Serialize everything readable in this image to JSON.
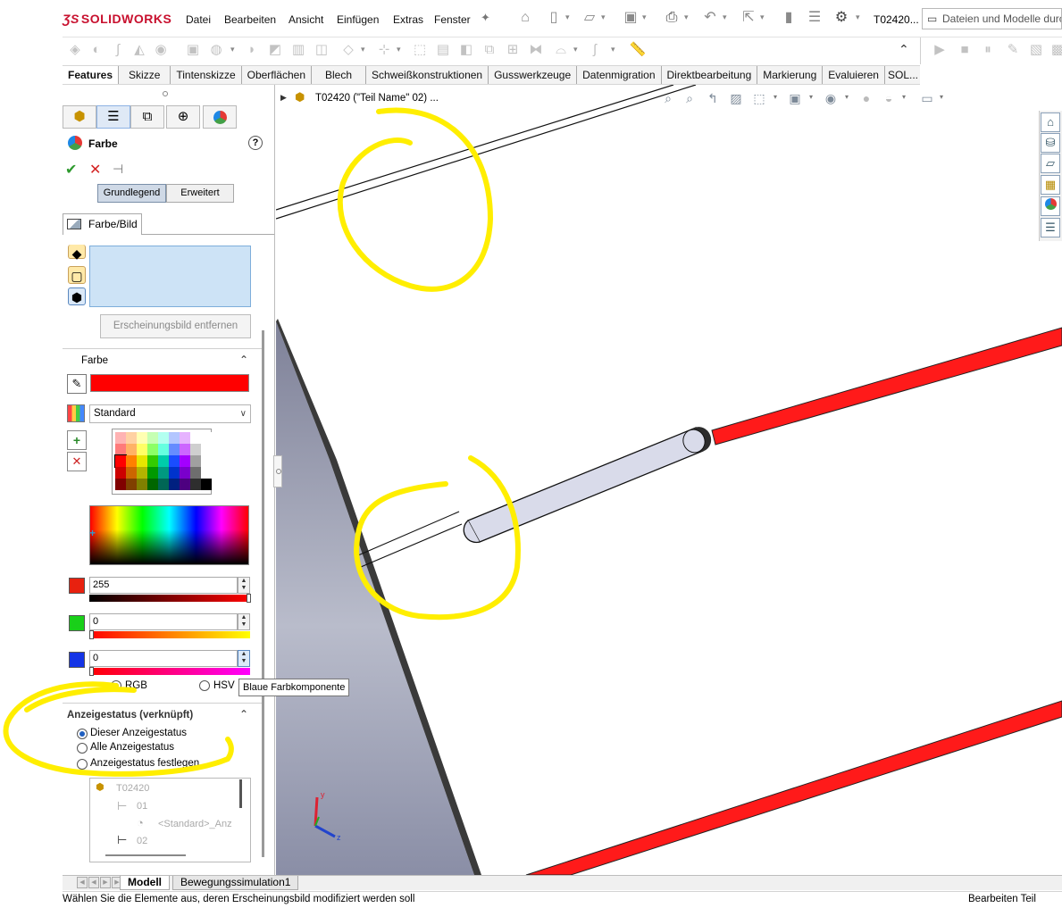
{
  "app": {
    "logo": "SOLIDWORKS",
    "doc_title": "T02420...",
    "search_placeholder": "Dateien und Modelle durch"
  },
  "menu": [
    "Datei",
    "Bearbeiten",
    "Ansicht",
    "Einfügen",
    "Extras",
    "Fenster"
  ],
  "command_tabs": [
    "Features",
    "Skizze",
    "Tintenskizze",
    "Oberflächen",
    "Blech",
    "Schweißkonstruktionen",
    "Gusswerkzeuge",
    "Datenmigration",
    "Direktbearbeitung",
    "Markierung",
    "Evaluieren",
    "SOL..."
  ],
  "property_manager": {
    "title": "Farbe",
    "modes": {
      "basic": "Grundlegend",
      "advanced": "Erweitert"
    },
    "sub_tab": "Farbe/Bild",
    "remove_appearance": "Erscheinungsbild entfernen",
    "color_section": "Farbe",
    "current_color": "#ff0000",
    "palette": "Standard",
    "channels": {
      "red": {
        "value": "255",
        "swatch": "#e8210f"
      },
      "green": {
        "value": "0",
        "swatch": "#19d019"
      },
      "blue": {
        "value": "0",
        "swatch": "#1434e6"
      }
    },
    "color_mode": {
      "rgb": "RGB",
      "hsv": "HSV",
      "selected": "RGB"
    },
    "tooltip": "Blaue Farbkomponente",
    "display_state": {
      "header": "Anzeigestatus (verknüpft)",
      "options": [
        "Dieser Anzeigestatus",
        "Alle Anzeigestatus",
        "Anzeigestatus festlegen"
      ],
      "selected": "Dieser Anzeigestatus",
      "tree": [
        "T02420",
        "01",
        "<Standard>_Anz",
        "02"
      ]
    }
  },
  "graphics": {
    "tree_label": "T02420 (\"Teil Name\" 02) ...",
    "triad_labels": {
      "y": "y",
      "z": "z"
    }
  },
  "bottom_tabs": [
    "Modell",
    "Bewegungssimulation1"
  ],
  "status": {
    "message": "Wählen Sie die Elemente aus, deren Erscheinungsbild modifiziert werden soll",
    "mode": "Bearbeiten Teil"
  },
  "colors": {
    "accent": "#1f5fc0",
    "highlight_rod": "#ff1a1a",
    "annotation": "#ffee00"
  }
}
